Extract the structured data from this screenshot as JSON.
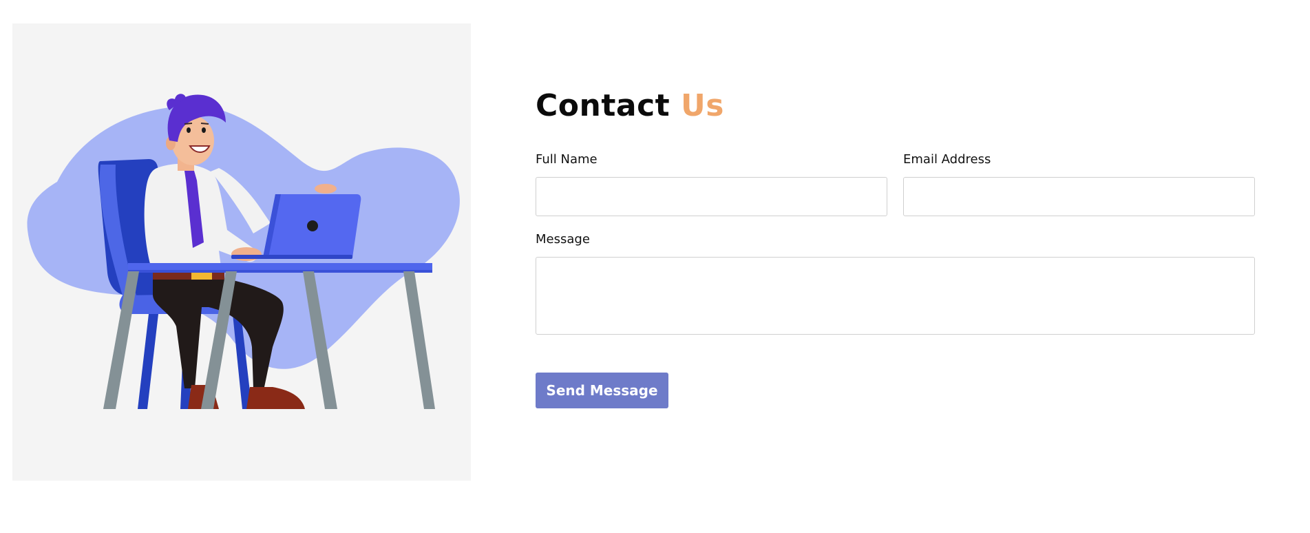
{
  "contact": {
    "title_main": "Contact",
    "title_accent": "Us",
    "full_name_label": "Full Name",
    "full_name_value": "",
    "email_label": "Email Address",
    "email_value": "",
    "message_label": "Message",
    "message_value": "",
    "submit_label": "Send Message"
  },
  "illustration": {
    "subject": "man-working-on-laptop-illustration"
  },
  "colors": {
    "accent": "#f0a66a",
    "button": "#6e7bc9",
    "illustration_background": "#f4f4f4",
    "blob": "#a6b4f6",
    "chair": "#2b46c8",
    "laptop": "#5468f0",
    "hair_and_tie": "#5b2fd0",
    "desk_legs": "#849196"
  }
}
